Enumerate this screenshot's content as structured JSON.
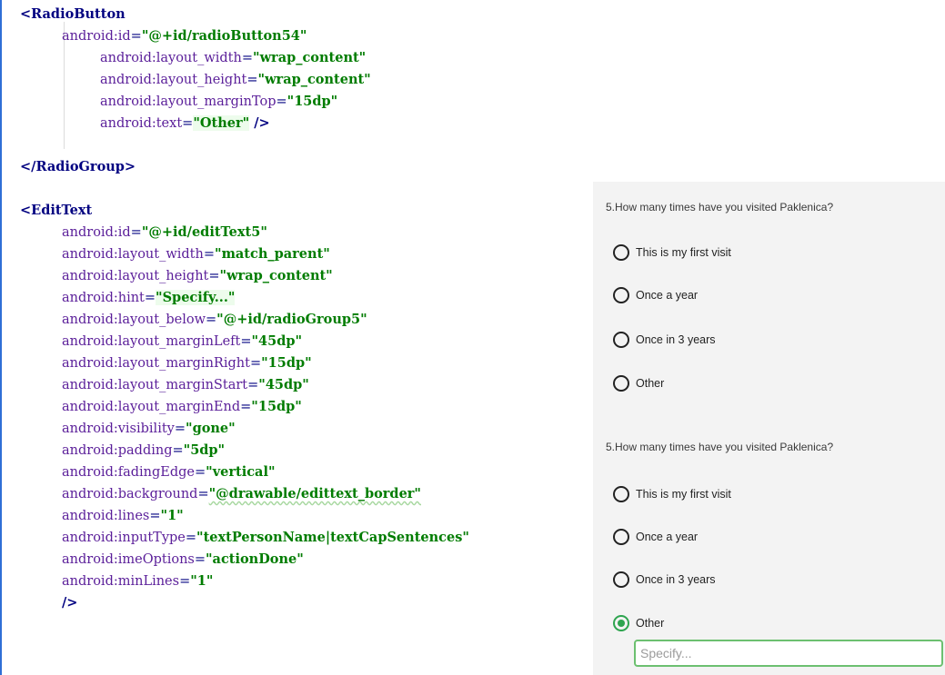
{
  "code": {
    "lines": [
      {
        "segments": [
          {
            "cls": "tag",
            "t": "<RadioButton"
          }
        ]
      },
      {
        "segments": [
          {
            "cls": "attr",
            "t": "android:id"
          },
          {
            "cls": "eq",
            "t": "="
          },
          {
            "cls": "val",
            "t": "\"@+id/radioButton54\""
          }
        ]
      },
      {
        "segments": [
          {
            "cls": "attr",
            "t": "android:layout_width"
          },
          {
            "cls": "eq",
            "t": "="
          },
          {
            "cls": "val",
            "t": "\"wrap_content\""
          }
        ]
      },
      {
        "segments": [
          {
            "cls": "attr",
            "t": "android:layout_height"
          },
          {
            "cls": "eq",
            "t": "="
          },
          {
            "cls": "val",
            "t": "\"wrap_content\""
          }
        ]
      },
      {
        "segments": [
          {
            "cls": "attr",
            "t": "android:layout_marginTop"
          },
          {
            "cls": "eq",
            "t": "="
          },
          {
            "cls": "val",
            "t": "\"15dp\""
          }
        ]
      },
      {
        "segments": [
          {
            "cls": "attr",
            "t": "android:text"
          },
          {
            "cls": "eq",
            "t": "="
          },
          {
            "cls": "val-hl",
            "t": "\"Other\""
          },
          {
            "cls": "tag",
            "t": " />"
          }
        ]
      },
      {
        "segments": []
      },
      {
        "segments": [
          {
            "cls": "tag",
            "t": "</RadioGroup>"
          }
        ]
      },
      {
        "segments": []
      },
      {
        "segments": [
          {
            "cls": "tag",
            "t": "<EditText"
          }
        ]
      },
      {
        "segments": [
          {
            "cls": "attr",
            "t": "android:id"
          },
          {
            "cls": "eq",
            "t": "="
          },
          {
            "cls": "val",
            "t": "\"@+id/editText5\""
          }
        ]
      },
      {
        "segments": [
          {
            "cls": "attr",
            "t": "android:layout_width"
          },
          {
            "cls": "eq",
            "t": "="
          },
          {
            "cls": "val",
            "t": "\"match_parent\""
          }
        ]
      },
      {
        "segments": [
          {
            "cls": "attr",
            "t": "android:layout_height"
          },
          {
            "cls": "eq",
            "t": "="
          },
          {
            "cls": "val",
            "t": "\"wrap_content\""
          }
        ]
      },
      {
        "segments": [
          {
            "cls": "attr",
            "t": "android:hint"
          },
          {
            "cls": "eq",
            "t": "="
          },
          {
            "cls": "hint-val",
            "t": "\"Specify...\""
          }
        ]
      },
      {
        "segments": [
          {
            "cls": "attr",
            "t": "android:layout_below"
          },
          {
            "cls": "eq",
            "t": "="
          },
          {
            "cls": "val",
            "t": "\"@+id/radioGroup5\""
          }
        ]
      },
      {
        "segments": [
          {
            "cls": "attr",
            "t": "android:layout_marginLeft"
          },
          {
            "cls": "eq",
            "t": "="
          },
          {
            "cls": "val",
            "t": "\"45dp\""
          }
        ]
      },
      {
        "segments": [
          {
            "cls": "attr",
            "t": "android:layout_marginRight"
          },
          {
            "cls": "eq",
            "t": "="
          },
          {
            "cls": "val",
            "t": "\"15dp\""
          }
        ]
      },
      {
        "segments": [
          {
            "cls": "attr",
            "t": "android:layout_marginStart"
          },
          {
            "cls": "eq",
            "t": "="
          },
          {
            "cls": "val",
            "t": "\"45dp\""
          }
        ]
      },
      {
        "segments": [
          {
            "cls": "attr",
            "t": "android:layout_marginEnd"
          },
          {
            "cls": "eq",
            "t": "="
          },
          {
            "cls": "val",
            "t": "\"15dp\""
          }
        ]
      },
      {
        "segments": [
          {
            "cls": "attr",
            "t": "android:visibility"
          },
          {
            "cls": "eq",
            "t": "="
          },
          {
            "cls": "val",
            "t": "\"gone\""
          }
        ]
      },
      {
        "segments": [
          {
            "cls": "attr",
            "t": "android:padding"
          },
          {
            "cls": "eq",
            "t": "="
          },
          {
            "cls": "val",
            "t": "\"5dp\""
          }
        ]
      },
      {
        "segments": [
          {
            "cls": "attr",
            "t": "android:fadingEdge"
          },
          {
            "cls": "eq",
            "t": "="
          },
          {
            "cls": "val",
            "t": "\"vertical\""
          }
        ]
      },
      {
        "segments": [
          {
            "cls": "attr",
            "t": "android:background"
          },
          {
            "cls": "eq",
            "t": "="
          },
          {
            "cls": "val",
            "t": "\"@drawable/edittext_border\""
          }
        ]
      },
      {
        "segments": [
          {
            "cls": "attr",
            "t": "android:lines"
          },
          {
            "cls": "eq",
            "t": "="
          },
          {
            "cls": "val",
            "t": "\"1\""
          }
        ]
      },
      {
        "segments": [
          {
            "cls": "attr",
            "t": "android:inputType"
          },
          {
            "cls": "eq",
            "t": "="
          },
          {
            "cls": "val",
            "t": "\"textPersonName|textCapSentences\""
          }
        ]
      },
      {
        "segments": [
          {
            "cls": "attr",
            "t": "android:imeOptions"
          },
          {
            "cls": "eq",
            "t": "="
          },
          {
            "cls": "val",
            "t": "\"actionDone\""
          }
        ]
      },
      {
        "segments": [
          {
            "cls": "attr",
            "t": "android:minLines"
          },
          {
            "cls": "eq",
            "t": "="
          },
          {
            "cls": "val",
            "t": "\"1\""
          }
        ]
      },
      {
        "segments": [
          {
            "cls": "tag",
            "t": "/>"
          }
        ]
      }
    ]
  },
  "preview": {
    "group1": {
      "question": "5.How many times have you visited Paklenica?",
      "options": [
        {
          "label": "This is my first visit",
          "checked": false
        },
        {
          "label": "Once a year",
          "checked": false
        },
        {
          "label": "Once in 3 years",
          "checked": false
        },
        {
          "label": "Other",
          "checked": false
        }
      ]
    },
    "group2": {
      "question": "5.How many times have you visited Paklenica?",
      "options": [
        {
          "label": "This is my first visit",
          "checked": false
        },
        {
          "label": "Once a year",
          "checked": false
        },
        {
          "label": "Once in 3 years",
          "checked": false
        },
        {
          "label": "Other",
          "checked": true
        }
      ]
    },
    "specify_placeholder": "Specify..."
  },
  "colors": {
    "accent": "#2ea44f",
    "editor_border": "#2f6fd6"
  }
}
